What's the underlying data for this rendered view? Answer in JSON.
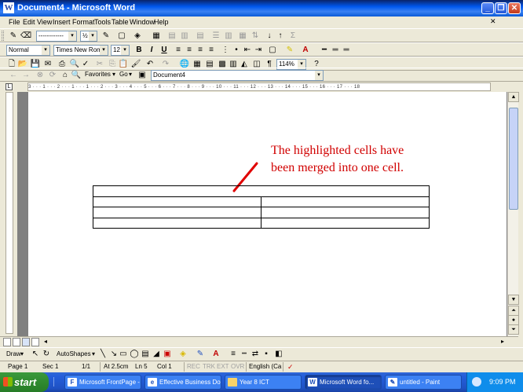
{
  "window": {
    "title": "Document4 - Microsoft Word",
    "app_icon": "W"
  },
  "menu": [
    "File",
    "Edit",
    "View",
    "Insert",
    "Format",
    "Tools",
    "Table",
    "Window",
    "Help"
  ],
  "formatting": {
    "style": "Normal",
    "font": "Times New Roman",
    "size": "12",
    "zoom": "114%",
    "border_line": "½"
  },
  "web": {
    "favorites": "Favorites",
    "go": "Go",
    "address": "Document4"
  },
  "ruler": {
    "text": "3 · · · 1 · · · 2 · · · 1 · · · 1 · · · 2 · · · 3 · · · 4 · · · 5 · · · 6 · · · 7 · · · 8 · · · 9 · · · 10 · · · 11 · · · 12 · · · 13 · · · 14 · · · 15 · · · 16 · · · 17 · · · 18"
  },
  "document": {
    "annotation_line1": "The highlighted cells have",
    "annotation_line2": "been merged into one cell.",
    "table_rows": 4
  },
  "drawing_toolbar": {
    "draw": "Draw",
    "autoshapes": "AutoShapes"
  },
  "status": {
    "page": "Page 1",
    "sec": "Sec 1",
    "pages": "1/1",
    "at": "At 2.5cm",
    "ln": "Ln 5",
    "col": "Col 1",
    "rec": "REC",
    "trk": "TRK",
    "ext": "EXT",
    "ovr": "OVR",
    "language": "English (Ca"
  },
  "taskbar": {
    "start": "start",
    "items": [
      {
        "label": "Microsoft FrontPage - ...",
        "active": false
      },
      {
        "label": "Effective Business Do...",
        "active": false
      },
      {
        "label": "Year 8 ICT",
        "active": false
      },
      {
        "label": "Microsoft Word fo...",
        "active": true
      },
      {
        "label": "untitled - Paint",
        "active": false
      }
    ],
    "clock": "9:09 PM"
  }
}
